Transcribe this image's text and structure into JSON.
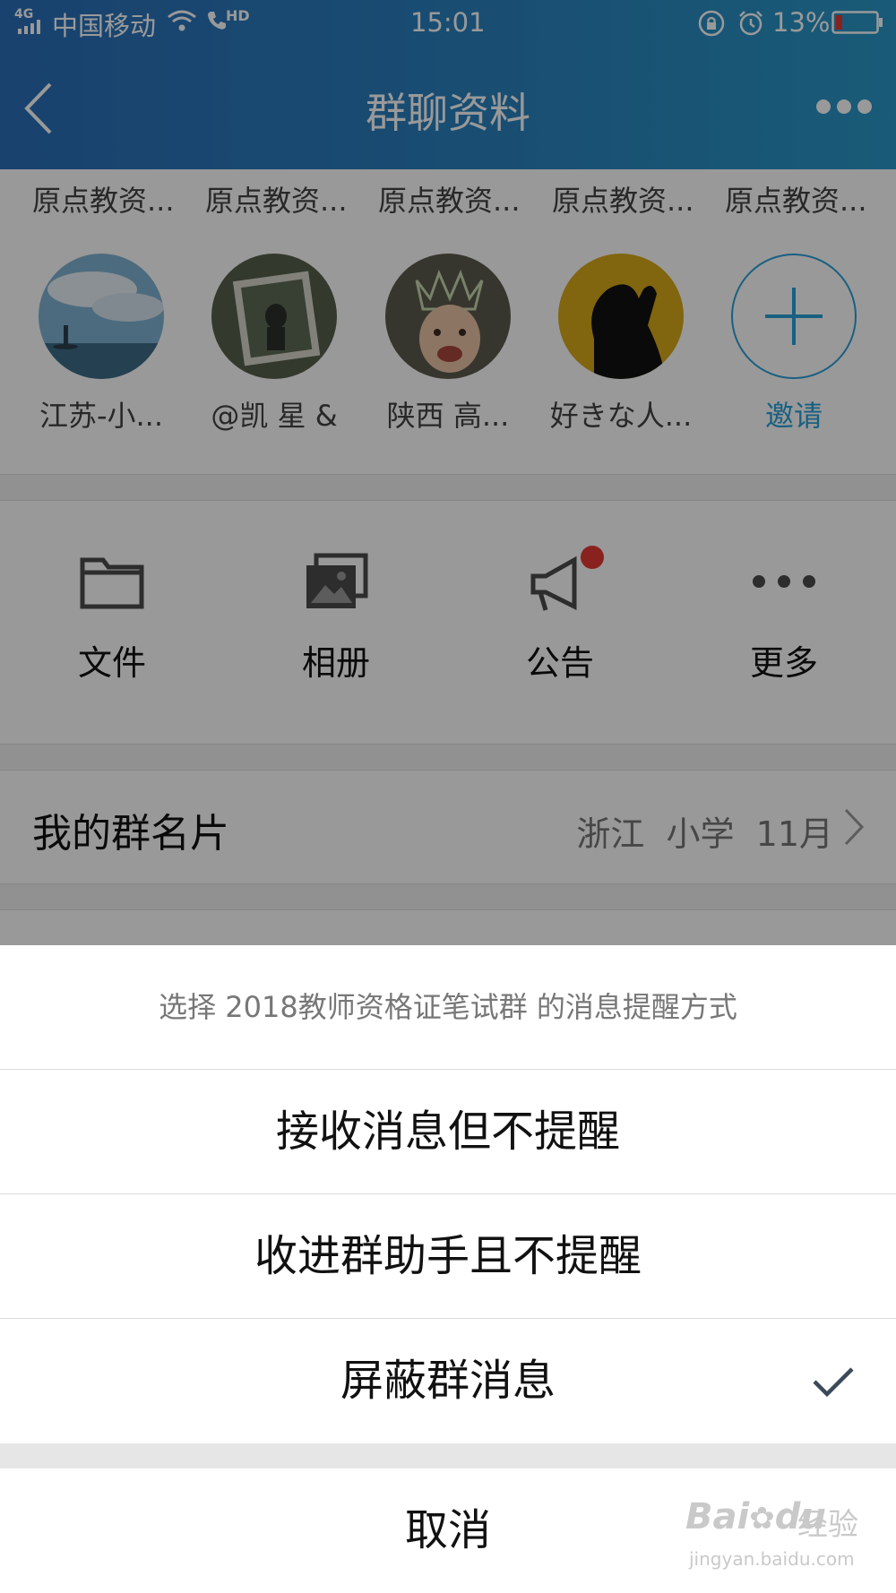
{
  "status_bar": {
    "network": "4G",
    "carrier": "中国移动",
    "hd": "HD",
    "time": "15:01",
    "battery": "13%"
  },
  "header": {
    "title": "群聊资料"
  },
  "members": [
    {
      "top": "原点教资...",
      "name": "江苏-小...",
      "avatar": "sea-lighthouse-avatar"
    },
    {
      "top": "原点教资...",
      "name": "@凯 星 &",
      "avatar": "forest-person-avatar"
    },
    {
      "top": "原点教资...",
      "name": "陕西 高...",
      "avatar": "baby-crown-avatar"
    },
    {
      "top": "原点教资...",
      "name": "好きな人...",
      "avatar": "silhouette-yellow-avatar"
    },
    {
      "top": "原点教资...",
      "name": "邀请",
      "avatar": "plus-icon"
    }
  ],
  "tools": [
    {
      "label": "文件",
      "icon": "folder-icon"
    },
    {
      "label": "相册",
      "icon": "album-icon"
    },
    {
      "label": "公告",
      "icon": "megaphone-icon"
    },
    {
      "label": "更多",
      "icon": "more-dots-icon"
    }
  ],
  "group_card": {
    "label": "我的群名片",
    "value": "浙江  小学  11月"
  },
  "sheet": {
    "prompt": "选择 2018教师资格证笔试群 的消息提醒方式",
    "options": [
      {
        "label": "接收消息但不提醒",
        "selected": false
      },
      {
        "label": "收进群助手且不提醒",
        "selected": false
      },
      {
        "label": "屏蔽群消息",
        "selected": true
      }
    ],
    "cancel": "取消"
  },
  "watermark": {
    "brand": "Bai",
    "brand2": "du",
    "suffix": "经验",
    "url": "jingyan.baidu.com"
  },
  "colors": {
    "header_gradient_start": "#2b6eb8",
    "header_gradient_end": "#2b98c8",
    "accent": "#2aa0d8",
    "badge": "#e53935"
  }
}
